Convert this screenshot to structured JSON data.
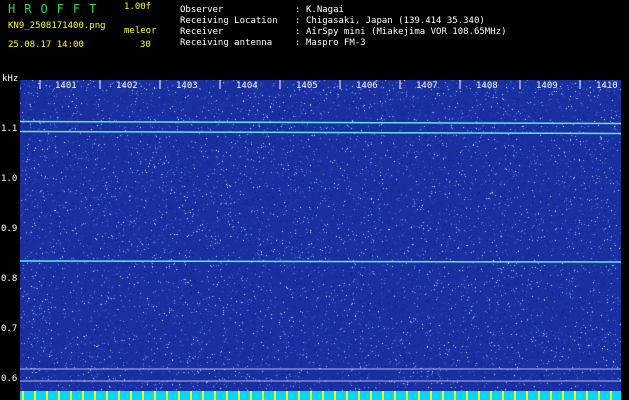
{
  "header": {
    "app_title": "HROFFT",
    "version": "1.00f",
    "filename": "KN9_2508171400.png",
    "mode": "meleor",
    "datetime": "25.08.17 14:00",
    "count": "30"
  },
  "info": [
    {
      "label": "Observer",
      "value": "K.Nagai"
    },
    {
      "label": "Receiving Location",
      "value": "Chigasaki, Japan (139.414 35.340)"
    },
    {
      "label": "Receiver",
      "value": "AirSpy mini (Miakejima VOR 108.65MHz)"
    },
    {
      "label": "Receiving antenna",
      "value": "Maspro FM-3"
    }
  ],
  "separator": ":",
  "spectrogram": {
    "y_unit": "kHz",
    "x_ticks": [
      "1401",
      "1402",
      "1403",
      "1404",
      "1405",
      "1406",
      "1407",
      "1408",
      "1409",
      "1410"
    ],
    "y_ticks": [
      "1.1",
      "1.0",
      "0.9",
      "0.8",
      "0.7",
      "0.6"
    ],
    "background_color": "#1a2fa0",
    "signal_lines_khz": [
      1.115,
      1.095,
      0.836
    ],
    "colors": {
      "text_yellow": "#ffff00",
      "title_green": "#22dd44",
      "signal": "#5fe8e0",
      "bottom_band": "#00d8ff"
    }
  }
}
